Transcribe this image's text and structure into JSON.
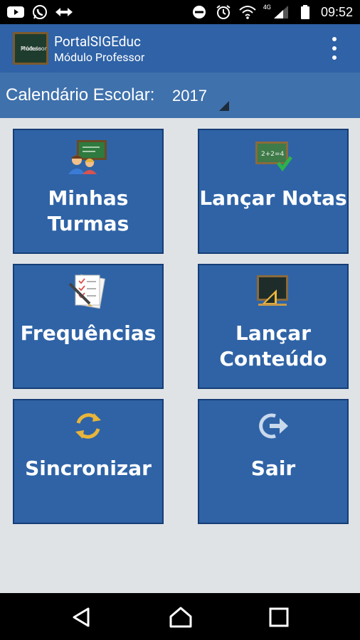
{
  "status_bar": {
    "time": "09:52",
    "network_type": "4G",
    "left_icons": [
      "youtube-icon",
      "whatsapp-icon",
      "teamviewer-icon"
    ],
    "right_icons": [
      "do-not-disturb-icon",
      "alarm-icon",
      "wifi-icon",
      "signal-icon",
      "battery-icon"
    ]
  },
  "app_bar": {
    "title": "PortalSIGEduc",
    "subtitle": "Módulo Professor",
    "logo_text_line1": "Módulo",
    "logo_text_line2": "Professor",
    "overflow_icon": "more-vert-icon"
  },
  "calendar": {
    "label": "Calendário Escolar:",
    "selected_year": "2017"
  },
  "tiles": [
    {
      "id": "minhas-turmas",
      "label_line1": "Minhas",
      "label_line2": "Turmas",
      "icon": "classroom-icon"
    },
    {
      "id": "lancar-notas",
      "label_line1": "Lançar Notas",
      "label_line2": "",
      "icon": "grades-board-icon"
    },
    {
      "id": "frequencias",
      "label_line1": "Frequências",
      "label_line2": "",
      "icon": "attendance-checklist-icon"
    },
    {
      "id": "lancar-conteudo",
      "label_line1": "Lançar",
      "label_line2": "Conteúdo",
      "icon": "chalkboard-icon"
    },
    {
      "id": "sincronizar",
      "label_line1": "Sincronizar",
      "label_line2": "",
      "icon": "sync-icon"
    },
    {
      "id": "sair",
      "label_line1": "Sair",
      "label_line2": "",
      "icon": "logout-icon"
    }
  ],
  "colors": {
    "app_bar": "#2f62a6",
    "calendar_bar": "#3f71ac",
    "tile_bg": "#2f63a6",
    "tile_border": "#163d75",
    "page_bg": "#dfe3e6",
    "sync_icon": "#e8b53a"
  },
  "nav_bar": [
    "back-icon",
    "home-icon",
    "recents-icon"
  ]
}
